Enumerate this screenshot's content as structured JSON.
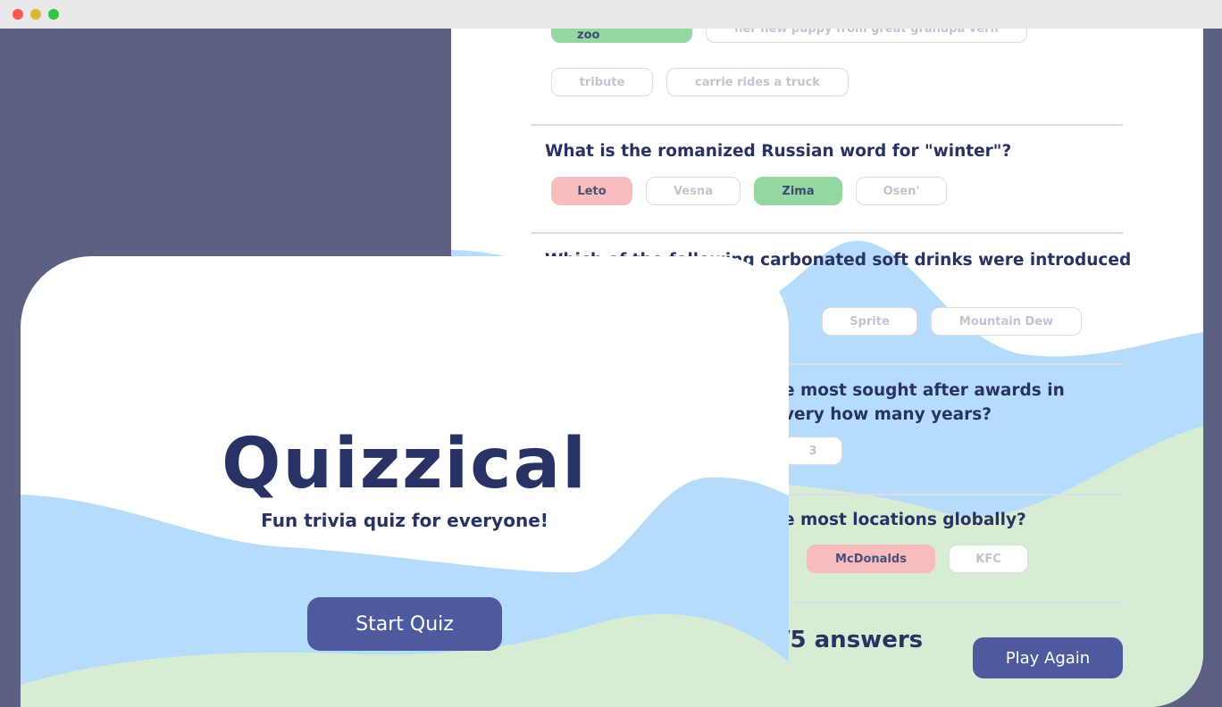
{
  "results": {
    "questions": [
      {
        "text": "",
        "answers": [
          {
            "label": "me at the zoo",
            "state": "correct"
          },
          {
            "label": "her new puppy from great grandpa vern",
            "state": "neutral"
          },
          {
            "label": "tribute",
            "state": "neutral"
          },
          {
            "label": "carrie rides a truck",
            "state": "neutral"
          }
        ]
      },
      {
        "text": "What is the romanized Russian word for \"winter\"?",
        "answers": [
          {
            "label": "Leto",
            "state": "wrong"
          },
          {
            "label": "Vesna",
            "state": "neutral"
          },
          {
            "label": "Zima",
            "state": "correct"
          },
          {
            "label": "Osen'",
            "state": "neutral"
          }
        ]
      },
      {
        "text": "Which of the following carbonated soft drinks were introduced",
        "answers": [
          {
            "label": "Sprite",
            "state": "neutral"
          },
          {
            "label": "Mountain Dew",
            "state": "neutral"
          }
        ]
      },
      {
        "text_line1": "e most sought after awards in",
        "text_line2": "very how many years?",
        "answers": [
          {
            "label": "3",
            "state": "neutral"
          }
        ]
      },
      {
        "text": "e most locations globally?",
        "answers": [
          {
            "label": "McDonalds",
            "state": "wrong"
          },
          {
            "label": "KFC",
            "state": "neutral"
          }
        ]
      }
    ],
    "score_text": "/5 answers",
    "play_again_label": "Play Again"
  },
  "start": {
    "title": "Quizzical",
    "subtitle": "Fun trivia quiz for everyone!",
    "start_label": "Start Quiz"
  },
  "colors": {
    "background": "#5c6184",
    "navy": "#293264",
    "button": "#4d5b9e",
    "blob_blue": "#b6dcfb",
    "blob_green": "#d6ecd3",
    "correct": "#94d7a2",
    "wrong": "#f8bcbc"
  }
}
